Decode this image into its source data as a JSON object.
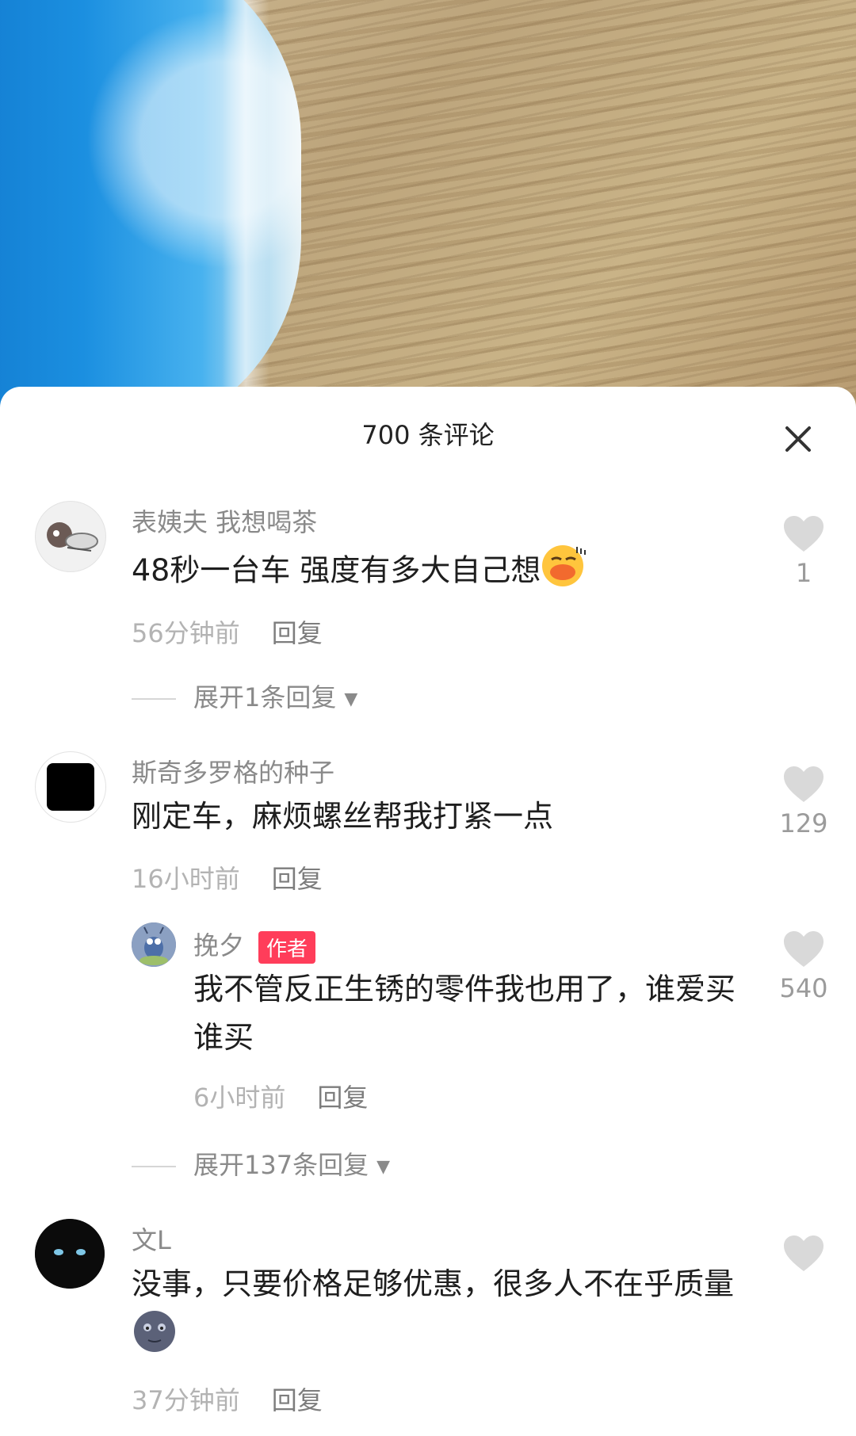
{
  "header": {
    "title": "700 条评论"
  },
  "comments": [
    {
      "user": "表姨夫 我想喝茶",
      "text": "48秒一台车 强度有多大自己想",
      "time": "56分钟前",
      "reply": "回复",
      "likes": "1",
      "expand": "展开1条回复"
    },
    {
      "user": "斯奇多罗格的种子",
      "text": "刚定车，麻烦螺丝帮我打紧一点",
      "time": "16小时前",
      "reply": "回复",
      "likes": "129",
      "sub": {
        "user": "挽夕",
        "badge": "作者",
        "text": "我不管反正生锈的零件我也用了，谁爱买谁买",
        "time": "6小时前",
        "reply": "回复",
        "likes": "540"
      },
      "expand": "展开137条回复"
    },
    {
      "user": "文L",
      "text": "没事，只要价格足够优惠，很多人不在乎质量",
      "time": "37分钟前",
      "reply": "回复",
      "likes": ""
    }
  ],
  "colors": {
    "badge": "#ff3d5a",
    "heart": "#d9d9d9"
  },
  "icons": {
    "close": "close-icon",
    "like": "heart-icon",
    "expand": "caret-down-icon"
  }
}
